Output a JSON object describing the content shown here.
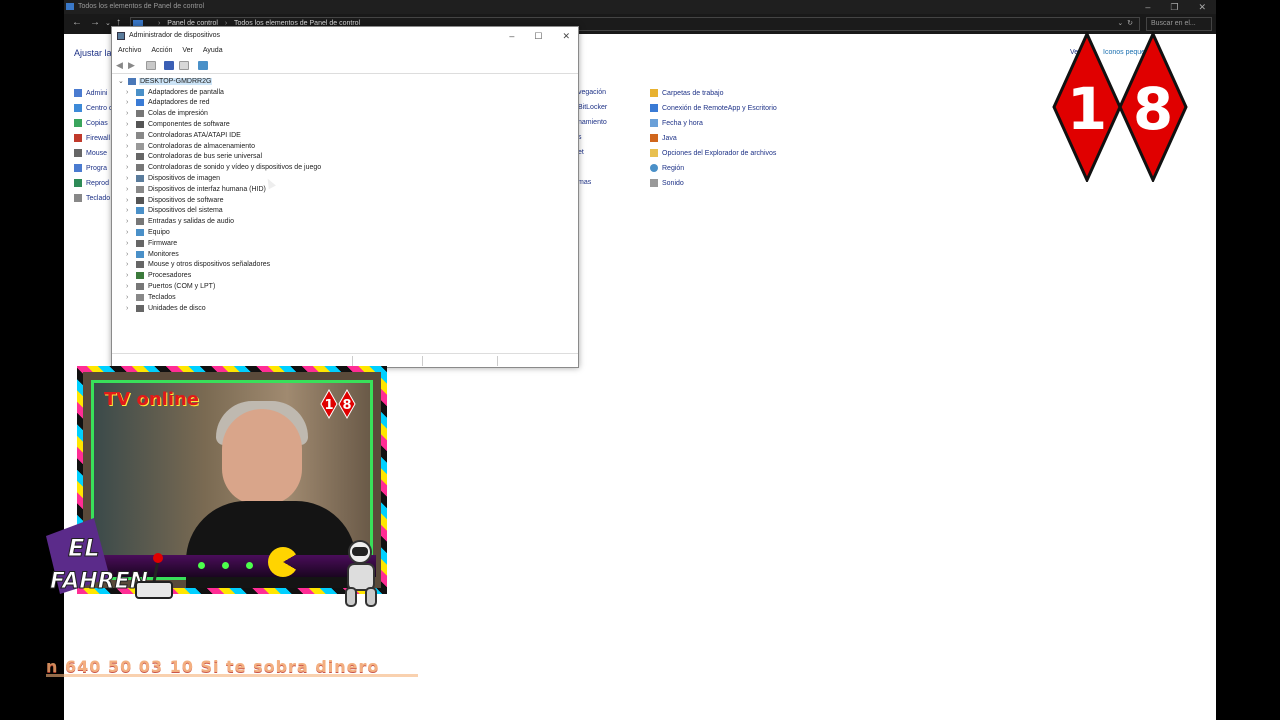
{
  "control_panel": {
    "window_title": "Todos los elementos de Panel de control",
    "window_buttons": [
      "–",
      "❐",
      "✕"
    ],
    "breadcrumb": [
      "Panel de control",
      "Todos los elementos de Panel de control"
    ],
    "search_placeholder": "Buscar en el...",
    "adjust_label": "Ajustar la",
    "view_by_label": "Ve",
    "view_by_value": "Iconos peque",
    "items_col1": [
      "Admini",
      "Centro d",
      "Copias",
      "Firewall",
      "Mouse",
      "Progra",
      "Reprod",
      "Teclado"
    ],
    "items_col3": [
      "vegación",
      "BitLocker",
      "namiento",
      "s",
      "et",
      "",
      "mas"
    ],
    "items_col4": [
      "Carpetas de trabajo",
      "Conexión de RemoteApp y Escritorio",
      "Fecha y hora",
      "Java",
      "Opciones del Explorador de archivos",
      "Región",
      "Sonido"
    ]
  },
  "device_manager": {
    "title": "Administrador de dispositivos",
    "window_buttons": [
      "–",
      "☐",
      "✕"
    ],
    "menu": [
      "Archivo",
      "Acción",
      "Ver",
      "Ayuda"
    ],
    "toolbar_icons": [
      "back-icon",
      "forward-icon",
      "properties-icon",
      "help-icon",
      "view-icon",
      "monitor-icon"
    ],
    "root": "DESKTOP-GMDRR2G",
    "categories": [
      "Adaptadores de pantalla",
      "Adaptadores de red",
      "Colas de impresión",
      "Componentes de software",
      "Controladoras ATA/ATAPI IDE",
      "Controladoras de almacenamiento",
      "Controladoras de bus serie universal",
      "Controladoras de sonido y vídeo y dispositivos de juego",
      "Dispositivos de imagen",
      "Dispositivos de interfaz humana (HID)",
      "Dispositivos de software",
      "Dispositivos del sistema",
      "Entradas y salidas de audio",
      "Equipo",
      "Firmware",
      "Monitores",
      "Mouse y otros dispositivos señaladores",
      "Procesadores",
      "Puertos (COM y LPT)",
      "Teclados",
      "Unidades de disco"
    ]
  },
  "overlay": {
    "badge_digits": [
      "1",
      "8"
    ],
    "cam_title": "TV online",
    "mini_badge": [
      "1",
      "8"
    ],
    "logo_text": [
      "EL",
      "FAHREN"
    ],
    "ticker": "n 640 50 03 10 Si te sobra dinero"
  },
  "colors": {
    "badge_red": "#e00000",
    "link_blue": "#1e3287",
    "link_green": "#2e8b57",
    "selection": "#cce4f7"
  }
}
